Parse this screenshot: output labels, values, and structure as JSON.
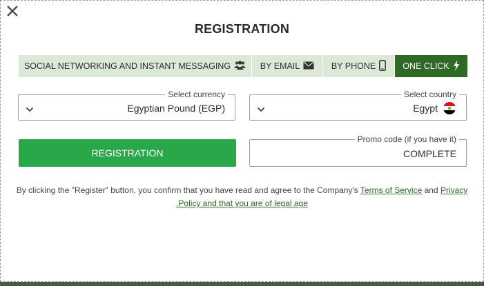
{
  "header": {
    "title": "REGISTRATION"
  },
  "tabs": [
    {
      "label": "SOCIAL NETWORKING AND INSTANT MESSAGING",
      "icon": "users-icon"
    },
    {
      "label": "BY EMAIL",
      "icon": "envelope-icon"
    },
    {
      "label": "BY PHONE",
      "icon": "phone-icon"
    },
    {
      "label": "ONE CLICK",
      "icon": "lightning-icon",
      "active": true
    }
  ],
  "currency": {
    "legend": "Select currency",
    "value": "Egyptian Pound (EGP)"
  },
  "country": {
    "legend": "Select country",
    "value": "Egypt",
    "flag": "egypt-flag"
  },
  "register_button": {
    "label": "REGISTRATION"
  },
  "promo": {
    "legend": "Promo code (if you have it)",
    "value": "COMPLETE"
  },
  "disclaimer": {
    "text_before": "By clicking the \"Register\" button, you confirm that you have read and agree to the Company's ",
    "terms_link": "Terms of Service",
    "and_text": " and ",
    "privacy_link_part1": "Privacy",
    "privacy_link_part2": ".Policy and that you are of legal age"
  },
  "colors": {
    "accent": "#2d6a26",
    "button": "#29a84a",
    "tab_bg": "#dbe9d6"
  }
}
